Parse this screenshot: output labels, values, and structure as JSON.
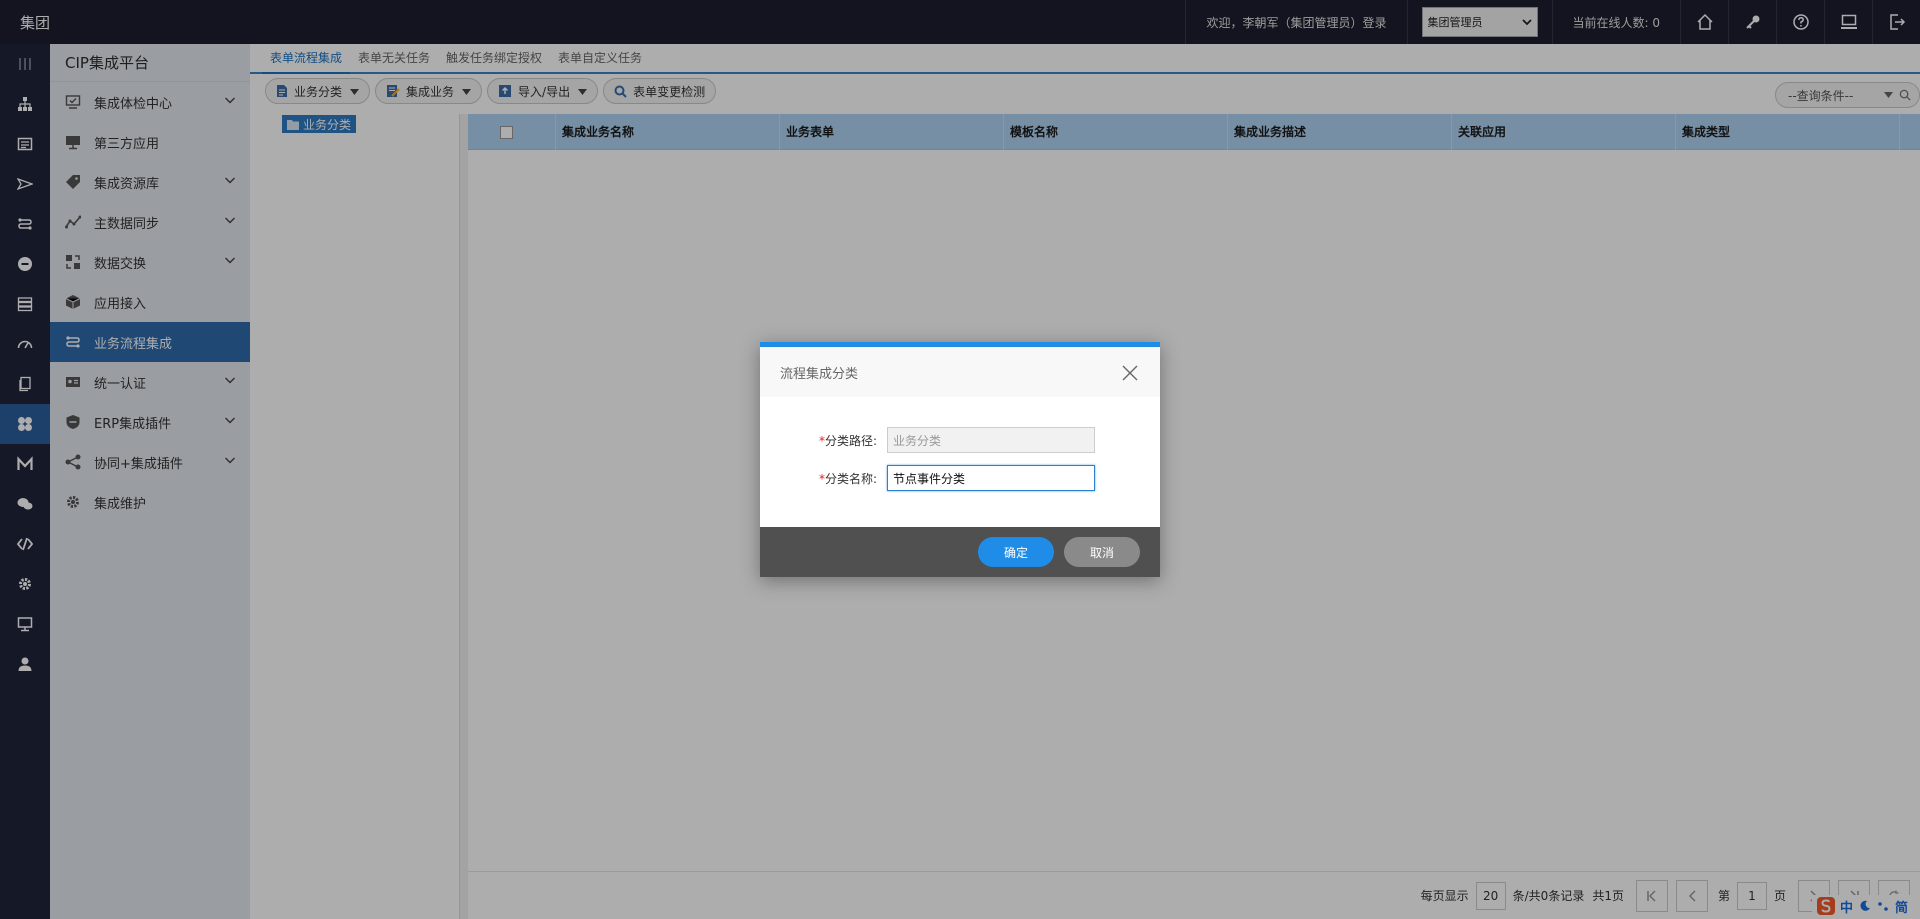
{
  "topbar": {
    "brand": "集团",
    "welcome": "欢迎，李朝军（集团管理员）登录",
    "role_select": "集团管理员",
    "online": "当前在线人数: 0",
    "icons": [
      "home-icon",
      "key-icon",
      "help-icon",
      "monitor-icon",
      "logout-icon"
    ]
  },
  "sidebar": {
    "title": "CIP集成平台",
    "items": [
      {
        "label": "集成体检中心",
        "icon": "monitor-check-icon",
        "expandable": true
      },
      {
        "label": "第三方应用",
        "icon": "desktop-icon",
        "expandable": false
      },
      {
        "label": "集成资源库",
        "icon": "tag-icon",
        "expandable": true
      },
      {
        "label": "主数据同步",
        "icon": "line-chart-icon",
        "expandable": true
      },
      {
        "label": "数据交换",
        "icon": "exchange-icon",
        "expandable": true
      },
      {
        "label": "应用接入",
        "icon": "cube-icon",
        "expandable": false
      },
      {
        "label": "业务流程集成",
        "icon": "flow-icon",
        "expandable": false,
        "active": true
      },
      {
        "label": "统一认证",
        "icon": "id-card-icon",
        "expandable": true
      },
      {
        "label": "ERP集成插件",
        "icon": "erp-icon",
        "expandable": true
      },
      {
        "label": "协同+集成插件",
        "icon": "share-icon",
        "expandable": true
      },
      {
        "label": "集成维护",
        "icon": "gear-icon",
        "expandable": false
      }
    ]
  },
  "tabs": [
    "表单流程集成",
    "表单无关任务",
    "触发任务绑定授权",
    "表单自定义任务"
  ],
  "toolbar": {
    "category": "业务分类",
    "integration": "集成业务",
    "import_export": "导入/导出",
    "check": "表单变更检测",
    "query": "--查询条件--"
  },
  "tree": {
    "root": "业务分类"
  },
  "grid": {
    "columns": [
      "集成业务名称",
      "业务表单",
      "模板名称",
      "集成业务描述",
      "关联应用",
      "集成类型"
    ]
  },
  "pager": {
    "per_page_label": "每页显示",
    "per_page": "20",
    "records": "条/共0条记录",
    "total_pages": "共1页",
    "page_label": "第",
    "page": "1",
    "page_suffix": "页"
  },
  "ime": {
    "mode": "中",
    "simp": "简"
  },
  "dialog": {
    "title": "流程集成分类",
    "path_label": "分类路径:",
    "path_value": "业务分类",
    "name_label": "分类名称:",
    "name_value": "节点事件分类",
    "ok": "确定",
    "cancel": "取消"
  }
}
